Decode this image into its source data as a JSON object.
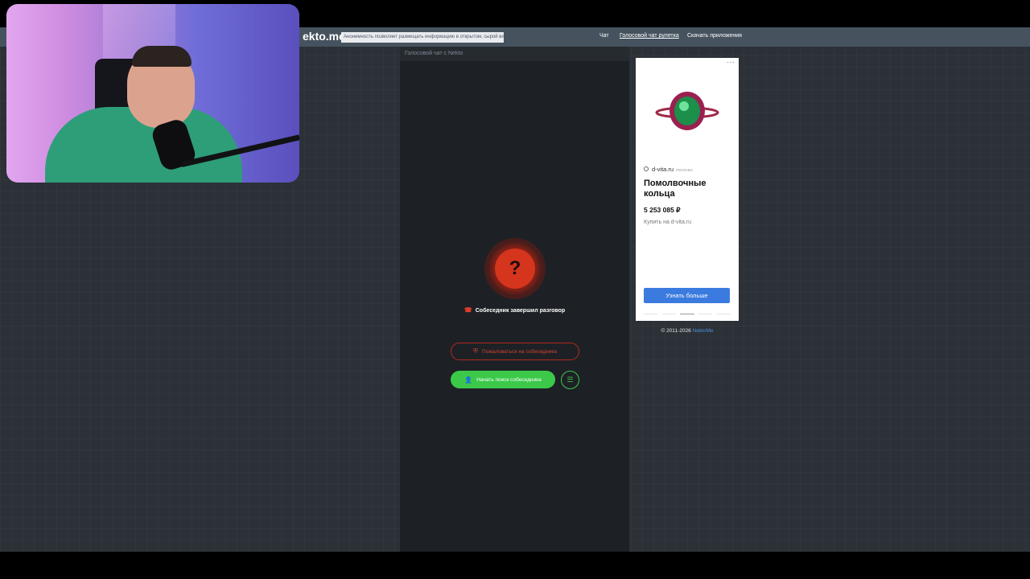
{
  "header": {
    "logo": "ekto.me",
    "notice": "Анонимность позволяет размещать информацию в открытом, сырой виде",
    "nav": [
      {
        "label": "Чат",
        "active": false
      },
      {
        "label": "Голосовой чат рулетка",
        "active": true
      },
      {
        "label": "Скачать приложения",
        "active": false
      }
    ]
  },
  "chat": {
    "header_title": "Голосовой чат с Nekto",
    "status_symbol": "?",
    "status_text": "Собеседник завершил разговор",
    "report_button": "Пожаловаться на собеседника",
    "search_button": "Начать поиск собеседника",
    "icons": {
      "status": "phone-hangup-icon",
      "report": "shield-icon",
      "search": "user-add-icon",
      "filter": "sliders-icon"
    }
  },
  "ad": {
    "domain": "d-vita.ru",
    "tag": "РЕКЛАМА",
    "title": "Помолвочные кольца",
    "price": "5 253 085 ₽",
    "subtitle": "Купить на d-vita.ru",
    "cta": "Узнать больше",
    "more": "···"
  },
  "footer": {
    "copyright": "© 2011-2026",
    "link": "NektoMe"
  },
  "colors": {
    "accent_red": "#d5341d",
    "accent_green": "#3cc94a",
    "cta_blue": "#3b7bdf",
    "background": "#2b3137"
  }
}
